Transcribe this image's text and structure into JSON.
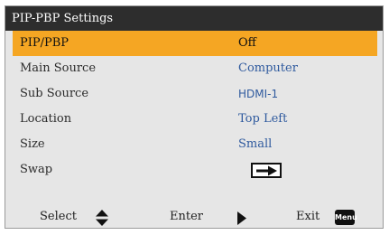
{
  "window": {
    "title": "PIP-PBP Settings"
  },
  "menu": {
    "items": [
      {
        "label": "PIP/PBP",
        "value": "Off",
        "selected": true
      },
      {
        "label": "Main Source",
        "value": "Computer"
      },
      {
        "label": "Sub Source",
        "value": "HDMI-1"
      },
      {
        "label": "Location",
        "value": "Top Left"
      },
      {
        "label": "Size",
        "value": "Small"
      },
      {
        "label": "Swap",
        "value_icon": "swap-arrow-icon"
      }
    ]
  },
  "footer": {
    "select_label": "Select",
    "enter_label": "Enter",
    "exit_label": "Exit",
    "menu_key_label": "Menu",
    "select_icon": "up-down-arrows-icon",
    "enter_icon": "right-triangle-icon"
  },
  "colors": {
    "highlight": "#f5a623",
    "title_bar": "#2d2d2d",
    "value_text": "#2f5a9e",
    "panel_bg": "#e6e6e6"
  }
}
